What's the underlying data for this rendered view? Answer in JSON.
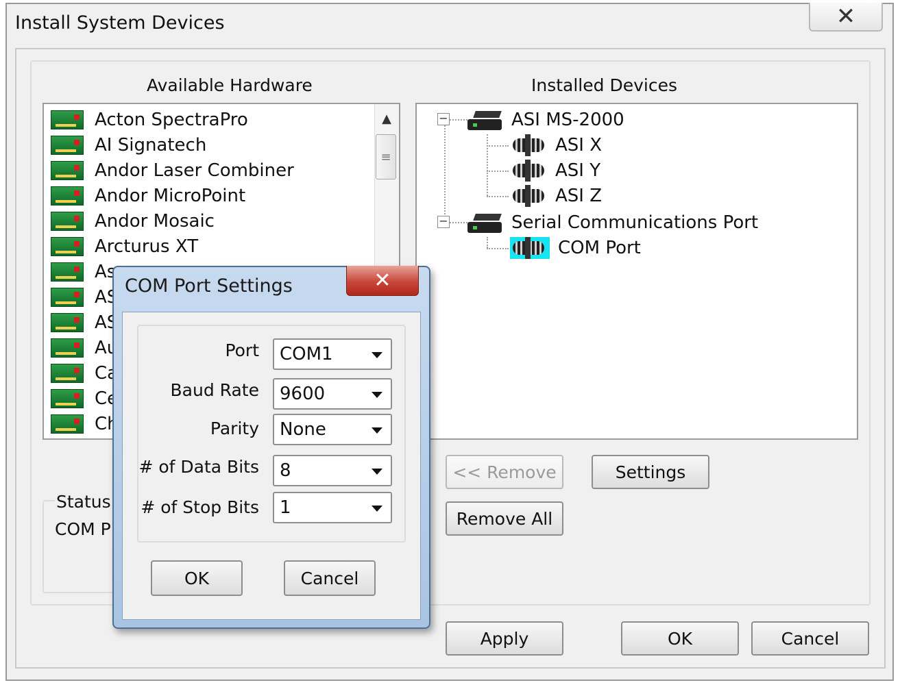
{
  "window": {
    "title": "Install System Devices",
    "close_glyph": "✕"
  },
  "available_hardware": {
    "header": "Available Hardware",
    "items": [
      "Acton SpectraPro",
      "AI Signatech",
      "Andor Laser Combiner",
      "Andor MicroPoint",
      "Andor Mosaic",
      "Arcturus XT",
      "As",
      "AS",
      "AS",
      "Au",
      "Ca",
      "Ce",
      "Ch"
    ]
  },
  "installed_devices": {
    "header": "Installed Devices",
    "tree": [
      {
        "label": "ASI MS-2000",
        "children": [
          "ASI X",
          "ASI Y",
          "ASI Z"
        ]
      },
      {
        "label": "Serial Communications Port",
        "children": [
          "COM Port"
        ]
      }
    ],
    "selected": "COM Port"
  },
  "buttons": {
    "remove": "<< Remove",
    "settings": "Settings",
    "remove_all": "Remove All",
    "apply": "Apply",
    "ok": "OK",
    "cancel": "Cancel"
  },
  "status": {
    "label": "Status",
    "text": "COM P"
  },
  "com_dialog": {
    "title": "COM Port Settings",
    "close_glyph": "✕",
    "fields": [
      {
        "label": "Port",
        "value": "COM1"
      },
      {
        "label": "Baud Rate",
        "value": "9600"
      },
      {
        "label": "Parity",
        "value": "None"
      },
      {
        "label": "# of Data Bits",
        "value": "8"
      },
      {
        "label": "# of Stop Bits",
        "value": "1"
      }
    ],
    "ok": "OK",
    "cancel": "Cancel"
  }
}
